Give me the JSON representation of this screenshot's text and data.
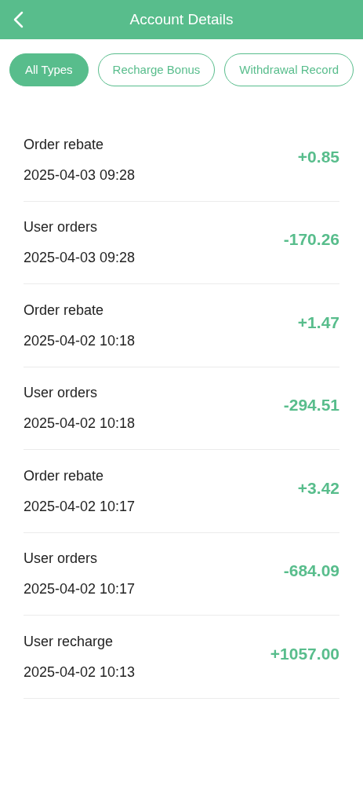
{
  "header": {
    "title": "Account Details"
  },
  "filters": [
    {
      "label": "All Types",
      "selected": true
    },
    {
      "label": "Recharge Bonus",
      "selected": false
    },
    {
      "label": "Withdrawal Record",
      "selected": false
    }
  ],
  "records": [
    {
      "title": "Order rebate",
      "time": "2025-04-03 09:28",
      "amount": "+0.85"
    },
    {
      "title": "User orders",
      "time": "2025-04-03 09:28",
      "amount": "-170.26"
    },
    {
      "title": "Order rebate",
      "time": "2025-04-02 10:18",
      "amount": "+1.47"
    },
    {
      "title": "User orders",
      "time": "2025-04-02 10:18",
      "amount": "-294.51"
    },
    {
      "title": "Order rebate",
      "time": "2025-04-02 10:17",
      "amount": "+3.42"
    },
    {
      "title": "User orders",
      "time": "2025-04-02 10:17",
      "amount": "-684.09"
    },
    {
      "title": "User recharge",
      "time": "2025-04-02 10:13",
      "amount": "+1057.00"
    }
  ]
}
